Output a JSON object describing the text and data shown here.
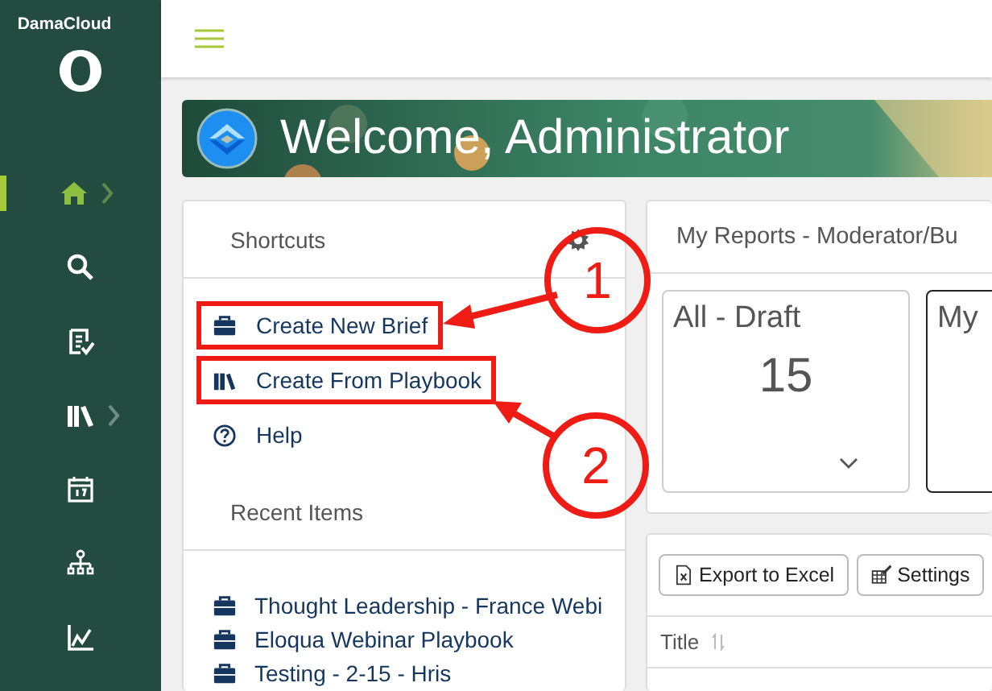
{
  "app": {
    "name": "DamaCloud"
  },
  "nav": [
    {
      "kind": "home",
      "selected": true,
      "expandable": true
    },
    {
      "kind": "search",
      "selected": false,
      "expandable": false
    },
    {
      "kind": "review",
      "selected": false,
      "expandable": false
    },
    {
      "kind": "library",
      "selected": false,
      "expandable": true
    },
    {
      "kind": "calendar",
      "selected": false,
      "expandable": false
    },
    {
      "kind": "hierarchy",
      "selected": false,
      "expandable": false
    },
    {
      "kind": "chart",
      "selected": false,
      "expandable": false
    }
  ],
  "banner": {
    "title": "Welcome, Administrator"
  },
  "shortcuts": {
    "title": "Shortcuts",
    "items": [
      {
        "kind": "brief",
        "label": "Create New Brief",
        "callout": "1"
      },
      {
        "kind": "playbook",
        "label": "Create From Playbook",
        "callout": "2"
      },
      {
        "kind": "help",
        "label": "Help"
      }
    ]
  },
  "recent": {
    "title": "Recent Items",
    "items": [
      {
        "label": "Thought Leadership - France Webi"
      },
      {
        "label": "Eloqua Webinar Playbook"
      },
      {
        "label": "Testing - 2-15 - Hris"
      }
    ]
  },
  "reports": {
    "title": "My Reports - Moderator/Bu",
    "tiles": [
      {
        "title": "All - Draft",
        "count": "15",
        "selected": false
      },
      {
        "title": "My",
        "selected": true
      }
    ]
  },
  "toolbar": {
    "buttons": [
      {
        "kind": "export",
        "label": "Export to Excel"
      },
      {
        "kind": "settings",
        "label": "Settings"
      }
    ]
  },
  "table": {
    "columns": [
      {
        "label": "Title",
        "sortable": true
      }
    ]
  }
}
